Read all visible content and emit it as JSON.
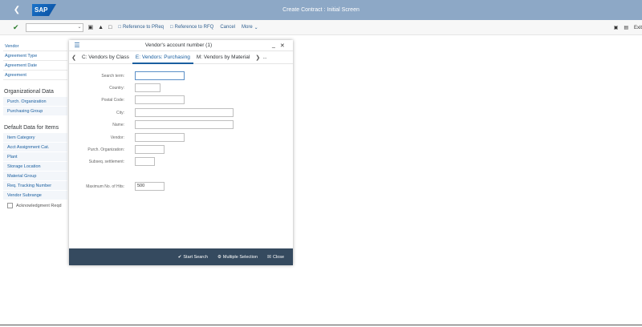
{
  "shell": {
    "title": "Create Contract : Initial Screen",
    "logo": "SAP",
    "back_icon": "back-arrow-icon"
  },
  "toolbar": {
    "check_icon": "checkmark-icon",
    "buttons": [
      "Reference to PReq",
      "Reference to RFQ",
      "Cancel",
      "More"
    ],
    "right_exit": "Exit"
  },
  "left_panel": {
    "top_items": [
      "Vendor",
      "Agreement Type",
      "Agreement Date",
      "Agreement"
    ],
    "org_heading": "Organizational Data",
    "org_items": [
      "Purch. Organization",
      "Purchasing Group"
    ],
    "default_heading": "Default Data for Items",
    "default_items": [
      "Item Category",
      "Acct Assignment Cat.",
      "Plant",
      "Storage Location",
      "Material Group",
      "Req. Tracking Number",
      "Vendor Subrange"
    ],
    "checkbox_label": "Acknowledgment Reqd"
  },
  "dialog": {
    "title": "Vendor's account number (1)",
    "tabs": [
      "C: Vendors by Class",
      "E: Vendors: Purchasing",
      "M: Vendors by Material"
    ],
    "active_tab": 1,
    "more": "...",
    "fields": [
      {
        "label": "Search term:",
        "value": ""
      },
      {
        "label": "Country:",
        "value": ""
      },
      {
        "label": "Postal Code:",
        "value": ""
      },
      {
        "label": "City:",
        "value": ""
      },
      {
        "label": "Name:",
        "value": ""
      },
      {
        "label": "Vendor:",
        "value": ""
      },
      {
        "label": "Purch. Organization:",
        "value": ""
      },
      {
        "label": "Subseq. settlement:",
        "value": ""
      },
      {
        "label": "Maximum No. of Hits:",
        "value": "500"
      }
    ],
    "footer": {
      "start_search": "Start Search",
      "multiple_selection": "Multiple Selection",
      "close": "Close"
    }
  }
}
